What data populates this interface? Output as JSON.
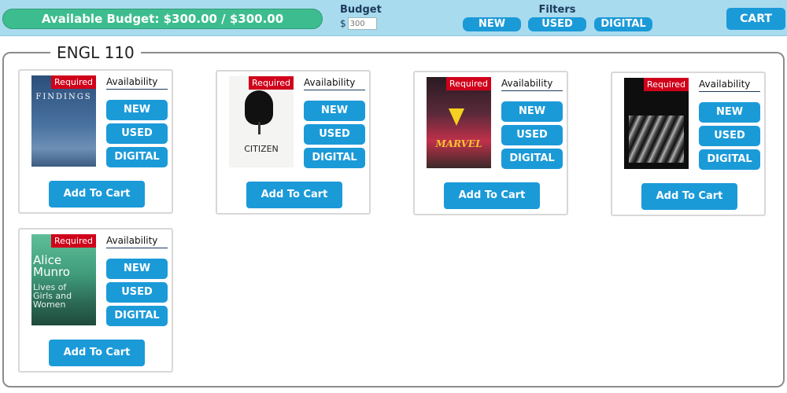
{
  "header": {
    "budget_label": "Available Budget: $300.00 / $300.00",
    "budget_title": "Budget",
    "budget_currency": "$",
    "budget_placeholder": "300",
    "filters_title": "Filters",
    "filters": [
      "NEW",
      "USED",
      "DIGITAL"
    ],
    "cart_label": "CART"
  },
  "section": {
    "title": "ENGL 110"
  },
  "card_labels": {
    "required": "Required",
    "availability": "Availability",
    "new": "NEW",
    "used": "USED",
    "digital": "DIGITAL",
    "add": "Add To Cart"
  },
  "books": [
    {
      "cover_lines": [
        "FINDINGS"
      ]
    },
    {
      "cover_lines": [
        "CITIZEN"
      ]
    },
    {
      "cover_lines": [
        "MARVEL"
      ]
    },
    {
      "cover_lines": []
    },
    {
      "cover_lines": [
        "Alice",
        "Munro",
        "Lives of",
        "Girls and",
        "Women"
      ]
    }
  ],
  "colors": {
    "budget_green": "#3dbd8f",
    "button_blue": "#1b9ad8",
    "required_red": "#d0021b",
    "topbar_blue": "#a9dbef"
  }
}
